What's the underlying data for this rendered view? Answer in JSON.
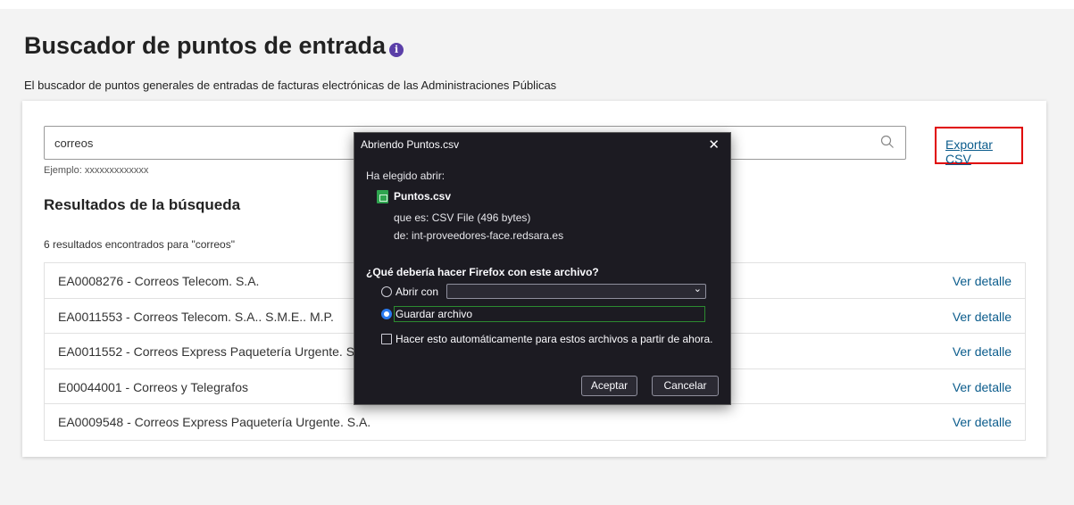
{
  "page": {
    "title": "Buscador de puntos de entrada",
    "subtitle": "El buscador de puntos generales de entradas de facturas electrónicas de las Administraciones Públicas"
  },
  "search": {
    "value": "correos",
    "example": "Ejemplo: xxxxxxxxxxxxx",
    "export_label": "Exportar CSV"
  },
  "results": {
    "title": "Resultados de la búsqueda",
    "count_text": "6 resultados encontrados para \"correos\"",
    "link_label": "Ver detalle",
    "items": [
      {
        "name": "EA0008276 - Correos Telecom. S.A."
      },
      {
        "name": "EA0011553 - Correos Telecom. S.A.. S.M.E.. M.P."
      },
      {
        "name": "EA0011552 - Correos Express Paquetería Urgente. S.A."
      },
      {
        "name": "E00044001 - Correos y Telegrafos"
      },
      {
        "name": "EA0009548 - Correos Express Paquetería Urgente. S.A."
      }
    ]
  },
  "dialog": {
    "title": "Abriendo Puntos.csv",
    "close": "✕",
    "chosen": "Ha elegido abrir:",
    "filename": "Puntos.csv",
    "type": "que es: CSV File (496 bytes)",
    "from": "de: int-proveedores-face.redsara.es",
    "question": "¿Qué debería hacer Firefox con este archivo?",
    "open_with": "Abrir con",
    "save_file": "Guardar archivo",
    "auto_label": "Hacer esto automáticamente para estos archivos a partir de ahora.",
    "accept": "Aceptar",
    "cancel": "Cancelar",
    "selected_option": "Guardar archivo"
  },
  "colors": {
    "link": "#0b5c8c",
    "highlight_border": "#e00000",
    "dialog_bg": "#1c1b22",
    "radio_checked": "#2a7bf0",
    "focus_border": "#2c8a30",
    "info_icon": "#5b3fa8"
  }
}
